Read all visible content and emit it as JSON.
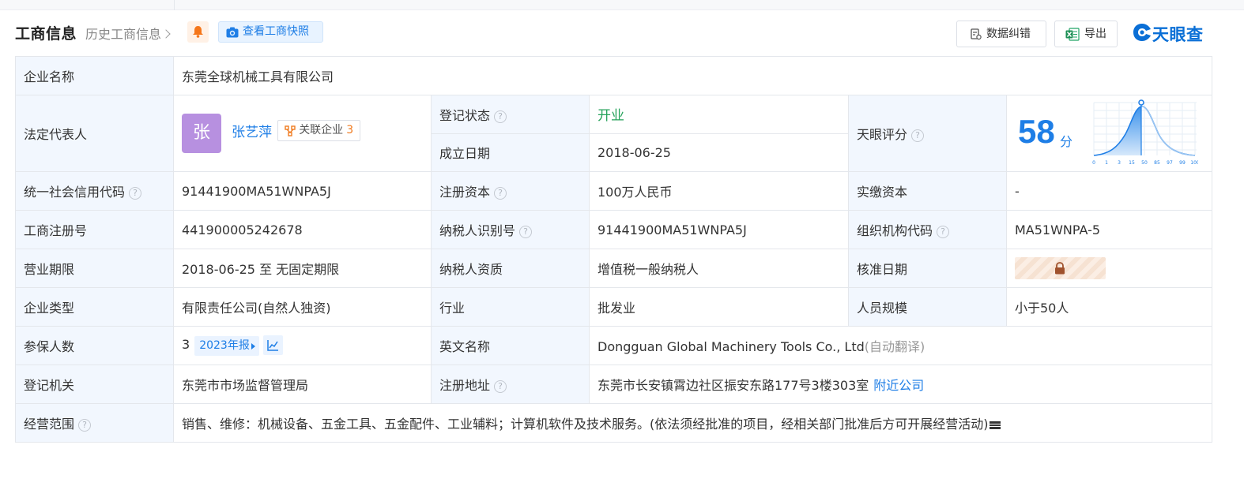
{
  "header": {
    "title": "工商信息",
    "history_link": "历史工商信息",
    "snapshot_label": "查看工商快照",
    "correct_label": "数据纠错",
    "export_label": "导出",
    "brand": "天眼查"
  },
  "company": {
    "name_label": "企业名称",
    "name_value": "东莞全球机械工具有限公司",
    "legal_rep_label": "法定代表人",
    "legal_rep_avatar": "张",
    "legal_rep_name": "张艺萍",
    "related_label": "关联企业",
    "related_count": "3",
    "reg_status_label": "登记状态",
    "reg_status_value": "开业",
    "found_date_label": "成立日期",
    "found_date_value": "2018-06-25",
    "score_label": "天眼评分",
    "score_value": "58",
    "score_unit": "分",
    "credit_code_label": "统一社会信用代码",
    "credit_code_value": "91441900MA51WNPA5J",
    "reg_capital_label": "注册资本",
    "reg_capital_value": "100万人民币",
    "paid_capital_label": "实缴资本",
    "paid_capital_value": "-",
    "biz_reg_no_label": "工商注册号",
    "biz_reg_no_value": "441900005242678",
    "taxpayer_id_label": "纳税人识别号",
    "taxpayer_id_value": "91441900MA51WNPA5J",
    "org_code_label": "组织机构代码",
    "org_code_value": "MA51WNPA-5",
    "biz_term_label": "营业期限",
    "biz_term_value": "2018-06-25 至 无固定期限",
    "taxpayer_qual_label": "纳税人资质",
    "taxpayer_qual_value": "增值税一般纳税人",
    "approval_date_label": "核准日期",
    "type_label": "企业类型",
    "type_value": "有限责任公司(自然人独资)",
    "industry_label": "行业",
    "industry_value": "批发业",
    "staff_label": "人员规模",
    "staff_value": "小于50人",
    "insured_label": "参保人数",
    "insured_value": "3",
    "insured_year": "2023年报",
    "english_label": "英文名称",
    "english_value": "Dongguan Global Machinery Tools Co., Ltd",
    "english_note": "(自动翻译)",
    "authority_label": "登记机关",
    "authority_value": "东莞市市场监督管理局",
    "address_label": "注册地址",
    "address_value": "东莞市长安镇霄边社区振安东路177号3楼303室",
    "nearby_link": "附近公司",
    "scope_label": "经营范围",
    "scope_value": "销售、维修：机械设备、五金工具、五金配件、工业辅料；计算机软件及技术服务。(依法须经批准的项目，经相关部门批准后方可开展经营活动)"
  },
  "score_chart": {
    "ticks": [
      "0",
      "1",
      "3",
      "15",
      "50",
      "85",
      "97",
      "99",
      "100"
    ]
  },
  "colors": {
    "accent": "#1e7ee6",
    "label_bg": "#f2f7fe",
    "status_green": "#25a25a",
    "related_orange": "#f07b20",
    "avatar_purple": "#b790e0"
  }
}
